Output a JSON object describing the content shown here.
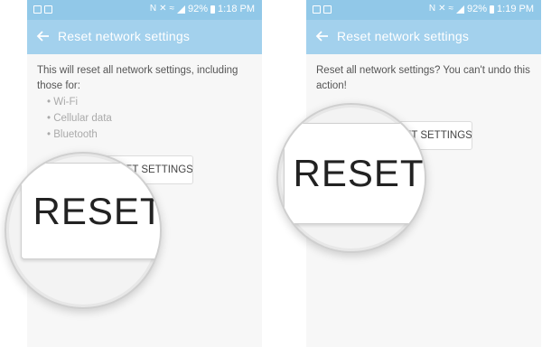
{
  "left": {
    "status": {
      "icons": [
        "nfc-icon",
        "mute-icon",
        "wifi-icon",
        "signal-icon"
      ],
      "battery": "92%",
      "time": "1:18 PM"
    },
    "appbar": {
      "title": "Reset network settings"
    },
    "description": "This will reset all network settings, including those for:",
    "bullets": [
      "Wi-Fi",
      "Cellular data",
      "Bluetooth"
    ],
    "button_label": "RESET SETTINGS",
    "magnified_label": "RESET"
  },
  "right": {
    "status": {
      "icons": [
        "nfc-icon",
        "mute-icon",
        "wifi-icon",
        "signal-icon"
      ],
      "battery": "92%",
      "time": "1:19 PM"
    },
    "appbar": {
      "title": "Reset network settings"
    },
    "description": "Reset all network settings? You can't undo this action!",
    "button_label": "RESET SETTINGS",
    "magnified_label": "RESET"
  },
  "colors": {
    "statusbar": "#91c8e8",
    "appbar": "#a3d1ed",
    "background": "#f7f7f7"
  }
}
